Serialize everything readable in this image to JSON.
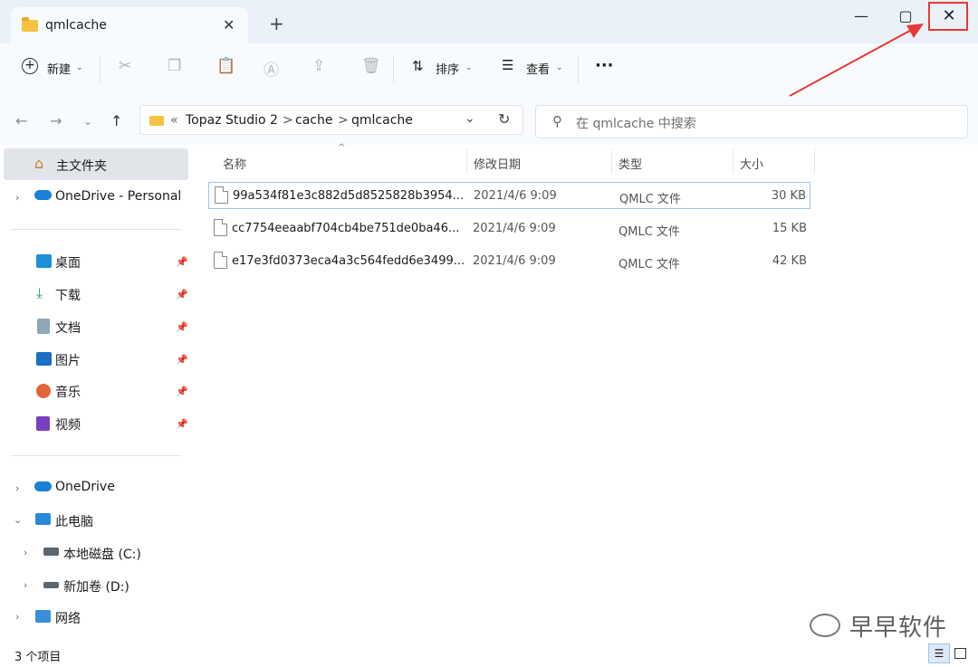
{
  "tab": {
    "title": "qmlcache",
    "close": "✕",
    "new_tab": "+"
  },
  "window_controls": {
    "minimize": "—",
    "maximize": "▢",
    "close": "✕"
  },
  "toolbar": {
    "new_label": "新建",
    "sort_label": "排序",
    "view_label": "查看",
    "more": "···"
  },
  "address": {
    "overflow": "«",
    "crumbs": [
      "Topaz Studio 2",
      "cache",
      "qmlcache"
    ],
    "separators": [
      ">",
      ">"
    ]
  },
  "search": {
    "placeholder": "在 qmlcache 中搜索"
  },
  "sidebar": {
    "home": "主文件夹",
    "onedrive_personal": "OneDrive - Personal",
    "pinned": [
      {
        "label": "桌面",
        "icon": "desktop-icon",
        "color": "#1e90d6"
      },
      {
        "label": "下载",
        "icon": "download-icon",
        "color": "#1aa179"
      },
      {
        "label": "文档",
        "icon": "document-icon",
        "color": "#6f8fa8"
      },
      {
        "label": "图片",
        "icon": "pictures-icon",
        "color": "#1d6fc4"
      },
      {
        "label": "音乐",
        "icon": "music-icon",
        "color": "#e2653a"
      },
      {
        "label": "视频",
        "icon": "video-icon",
        "color": "#7a3fc1"
      }
    ],
    "onedrive": "OneDrive",
    "this_pc": "此电脑",
    "drive_c": "本地磁盘 (C:)",
    "drive_d": "新加卷 (D:)",
    "network": "网络"
  },
  "columns": {
    "name": "名称",
    "modified": "修改日期",
    "type": "类型",
    "size": "大小"
  },
  "files": [
    {
      "name": "99a534f81e3c882d5d8525828b3954...",
      "modified": "2021/4/6 9:09",
      "type": "QMLC 文件",
      "size": "30 KB"
    },
    {
      "name": "cc7754eeaabf704cb4be751de0ba46...",
      "modified": "2021/4/6 9:09",
      "type": "QMLC 文件",
      "size": "15 KB"
    },
    {
      "name": "e17e3fd0373eca4a3c564fedd6e3499...",
      "modified": "2021/4/6 9:09",
      "type": "QMLC 文件",
      "size": "42 KB"
    }
  ],
  "status": {
    "count": "3 个项目"
  },
  "watermark": "早早软件",
  "colors": {
    "accent": "#1e6fd9",
    "highlight": "#e53935",
    "titlebar": "#eaf1f9"
  }
}
